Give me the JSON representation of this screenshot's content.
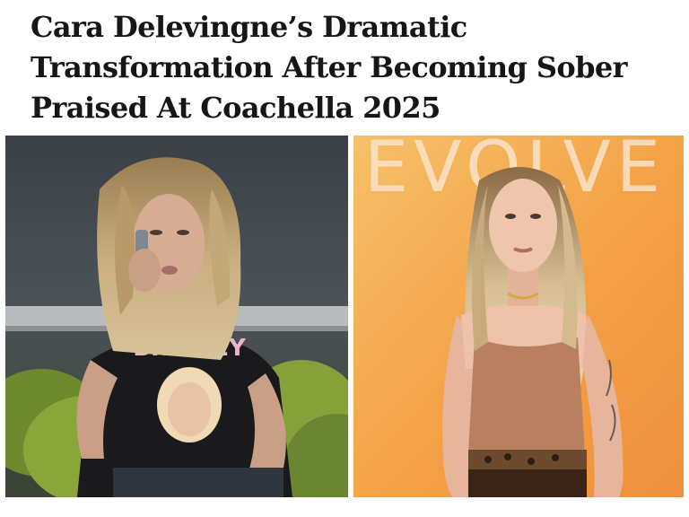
{
  "article": {
    "headline_lines": [
      "Cara Delevingne’s Dramatic",
      "Transformation After Becoming Sober",
      "Praised At Coachella 2025"
    ]
  },
  "photos": {
    "left": {
      "shirt_print": "BRITNEY"
    },
    "right": {
      "backdrop_sign": "EVOLVE"
    }
  },
  "colors": {
    "headline": "#161616",
    "background": "#ffffff",
    "backdrop_orange": "#f5a347",
    "top_tan": "#b98060"
  }
}
